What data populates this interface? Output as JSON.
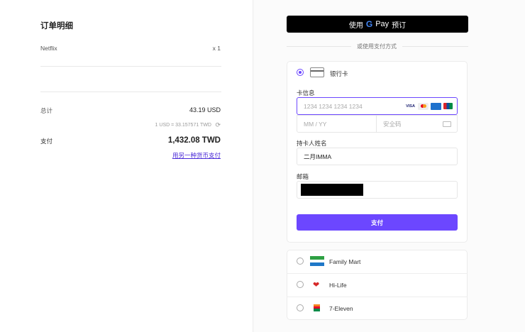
{
  "order": {
    "title": "订单明细",
    "item_name": "Netflix",
    "item_qty": "x 1",
    "total_label": "总计",
    "total_value": "43.19 USD",
    "rate": "1 USD = 33.157571 TWD",
    "pay_label": "支付",
    "pay_value": "1,432.08 TWD",
    "other_currency_link": "用另一种货币支付"
  },
  "payment": {
    "gpay_prefix": "使用",
    "gpay_brand": "Pay",
    "gpay_suffix": "预订",
    "divider": "或使用支付方式",
    "bank_card": {
      "label": "银行卡",
      "card_info_label": "卡信息",
      "card_number_placeholder": "1234 1234 1234 1234",
      "brands": [
        "VISA",
        "MC",
        "AMEX",
        "UnionPay"
      ],
      "expiry_placeholder": "MM / YY",
      "cvc_placeholder": "安全码",
      "holder_label": "持卡人姓名",
      "holder_value": "二月IMMA",
      "email_label": "邮箱",
      "pay_button": "支付"
    },
    "stores": [
      {
        "name": "Family Mart"
      },
      {
        "name": "Hi-Life"
      },
      {
        "name": "7-Eleven"
      }
    ]
  },
  "colors": {
    "accent": "#6c47ff"
  }
}
